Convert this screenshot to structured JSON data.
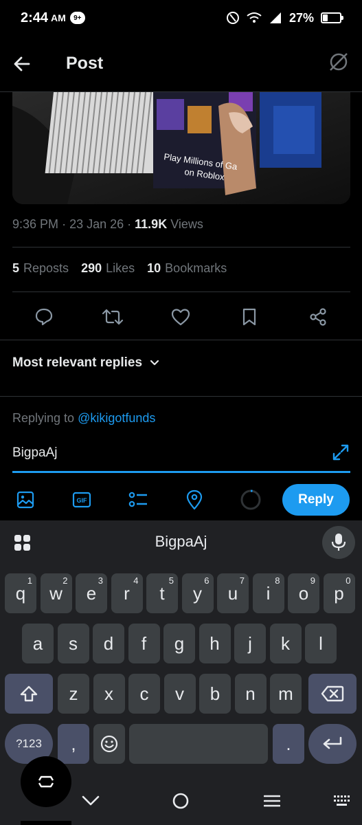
{
  "status_bar": {
    "time": "2:44",
    "ampm": "AM",
    "notification_badge": "9+",
    "battery_text": "27%",
    "battery_level": 0.27
  },
  "header": {
    "title": "Post"
  },
  "media": {
    "caption_line1": "Play Millions of Ga",
    "caption_line2": "on Roblox"
  },
  "meta": {
    "time": "9:36 PM",
    "date": "23 Jan 26",
    "views_count": "11.9K",
    "views_label": "Views"
  },
  "stats": {
    "reposts_count": "5",
    "reposts_label": "Reposts",
    "likes_count": "290",
    "likes_label": "Likes",
    "bookmarks_count": "10",
    "bookmarks_label": "Bookmarks"
  },
  "sort": {
    "label": "Most relevant replies"
  },
  "reply": {
    "replying_prefix": "Replying to",
    "handle": "@kikigotfunds",
    "text": "BigpaAj",
    "button_label": "Reply"
  },
  "keyboard": {
    "suggestion": "BigpaAj",
    "row1": [
      {
        "k": "q",
        "n": "1"
      },
      {
        "k": "w",
        "n": "2"
      },
      {
        "k": "e",
        "n": "3"
      },
      {
        "k": "r",
        "n": "4"
      },
      {
        "k": "t",
        "n": "5"
      },
      {
        "k": "y",
        "n": "6"
      },
      {
        "k": "u",
        "n": "7"
      },
      {
        "k": "i",
        "n": "8"
      },
      {
        "k": "o",
        "n": "9"
      },
      {
        "k": "p",
        "n": "0"
      }
    ],
    "row2": [
      "a",
      "s",
      "d",
      "f",
      "g",
      "h",
      "j",
      "k",
      "l"
    ],
    "row3": [
      "z",
      "x",
      "c",
      "v",
      "b",
      "n",
      "m"
    ],
    "symbols_label": "?123",
    "comma": ",",
    "period": "."
  },
  "colors": {
    "accent": "#1d9bf0",
    "background": "#000000",
    "keyboard_bg": "#202124",
    "key_bg": "#3c4043"
  }
}
